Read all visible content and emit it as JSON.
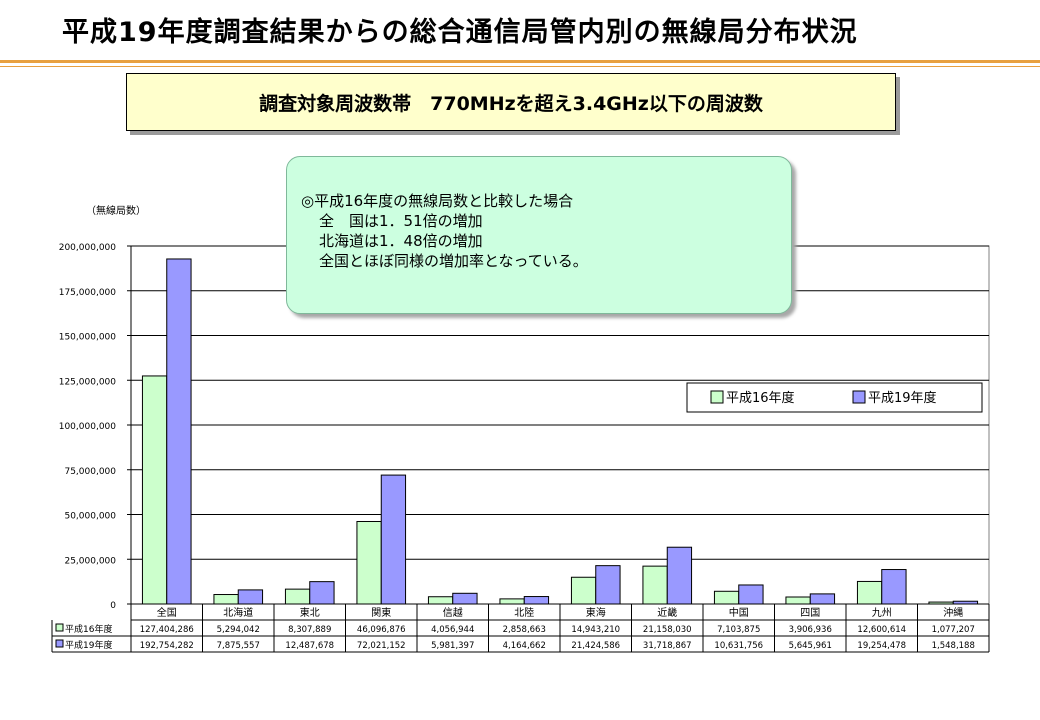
{
  "page": {
    "title": "平成19年度調査結果からの総合通信局管内別の無線局分布状況",
    "band_label": "調査対象周波数帯　770MHzを超え3.4GHz以下の周波数",
    "note": {
      "heading": "◎平成16年度の無線局数と比較した場合",
      "lines": [
        "全　国は1．51倍の増加",
        "北海道は1．48倍の増加",
        "全国とほぼ同様の増加率となっている。"
      ]
    }
  },
  "chart_data": {
    "type": "bar",
    "ylabel": "（無線局数）",
    "ylim": [
      0,
      200000000
    ],
    "ytick_values": [
      0,
      25000000,
      50000000,
      75000000,
      100000000,
      125000000,
      150000000,
      175000000,
      200000000
    ],
    "ytick_labels": [
      "0",
      "25,000,000",
      "50,000,000",
      "75,000,000",
      "100,000,000",
      "125,000,000",
      "150,000,000",
      "175,000,000",
      "200,000,000"
    ],
    "grid": true,
    "legend_position": "right",
    "categories": [
      "全国",
      "北海道",
      "東北",
      "関東",
      "信越",
      "北陸",
      "東海",
      "近畿",
      "中国",
      "四国",
      "九州",
      "沖縄"
    ],
    "series": [
      {
        "name": "平成16年度",
        "color": "#ccffcc",
        "values": [
          127404286,
          5294042,
          8307889,
          46096876,
          4056944,
          2858663,
          14943210,
          21158030,
          7103875,
          3906936,
          12600614,
          1077207
        ],
        "labels": [
          "127,404,286",
          "5,294,042",
          "8,307,889",
          "46,096,876",
          "4,056,944",
          "2,858,663",
          "14,943,210",
          "21,158,030",
          "7,103,875",
          "3,906,936",
          "12,600,614",
          "1,077,207"
        ]
      },
      {
        "name": "平成19年度",
        "color": "#9999ff",
        "values": [
          192754282,
          7875557,
          12487678,
          72021152,
          5981397,
          4164662,
          21424586,
          31718867,
          10631756,
          5645961,
          19254478,
          1548188
        ],
        "labels": [
          "192,754,282",
          "7,875,557",
          "12,487,678",
          "72,021,152",
          "5,981,397",
          "4,164,662",
          "21,424,586",
          "31,718,867",
          "10,631,756",
          "5,645,961",
          "19,254,478",
          "1,548,188"
        ]
      }
    ]
  }
}
